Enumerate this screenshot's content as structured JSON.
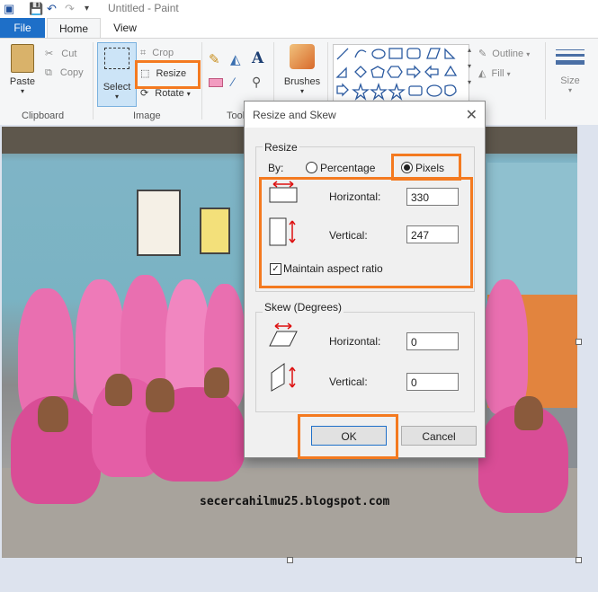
{
  "window": {
    "title": "Untitled - Paint"
  },
  "tabs": {
    "file": "File",
    "home": "Home",
    "view": "View"
  },
  "ribbon": {
    "clipboard": {
      "paste": "Paste",
      "cut": "Cut",
      "copy": "Copy",
      "label": "Clipboard"
    },
    "image": {
      "select": "Select",
      "crop": "Crop",
      "resize": "Resize",
      "rotate": "Rotate",
      "label": "Image"
    },
    "tools": {
      "label": "Tools"
    },
    "brushes": {
      "label": "Brushes"
    },
    "shapes": {
      "outline": "Outline",
      "fill": "Fill"
    },
    "size": {
      "label": "Size"
    }
  },
  "canvas": {
    "watermark": "secercahilmu25.blogspot.com"
  },
  "dialog": {
    "title": "Resize and Skew",
    "resize_legend": "Resize",
    "by_label": "By:",
    "percentage_label": "Percentage",
    "pixels_label": "Pixels",
    "selected_unit": "Pixels",
    "horizontal_label": "Horizontal:",
    "horizontal_value": "330",
    "vertical_label": "Vertical:",
    "vertical_value": "247",
    "aspect_label": "Maintain aspect ratio",
    "aspect_checked": true,
    "skew_legend": "Skew (Degrees)",
    "skew_horizontal_label": "Horizontal:",
    "skew_horizontal_value": "0",
    "skew_vertical_label": "Vertical:",
    "skew_vertical_value": "0",
    "ok": "OK",
    "cancel": "Cancel"
  },
  "colors": {
    "accent": "#1e6fc8",
    "highlight": "#f47a20",
    "pink": "#e85aa8"
  }
}
